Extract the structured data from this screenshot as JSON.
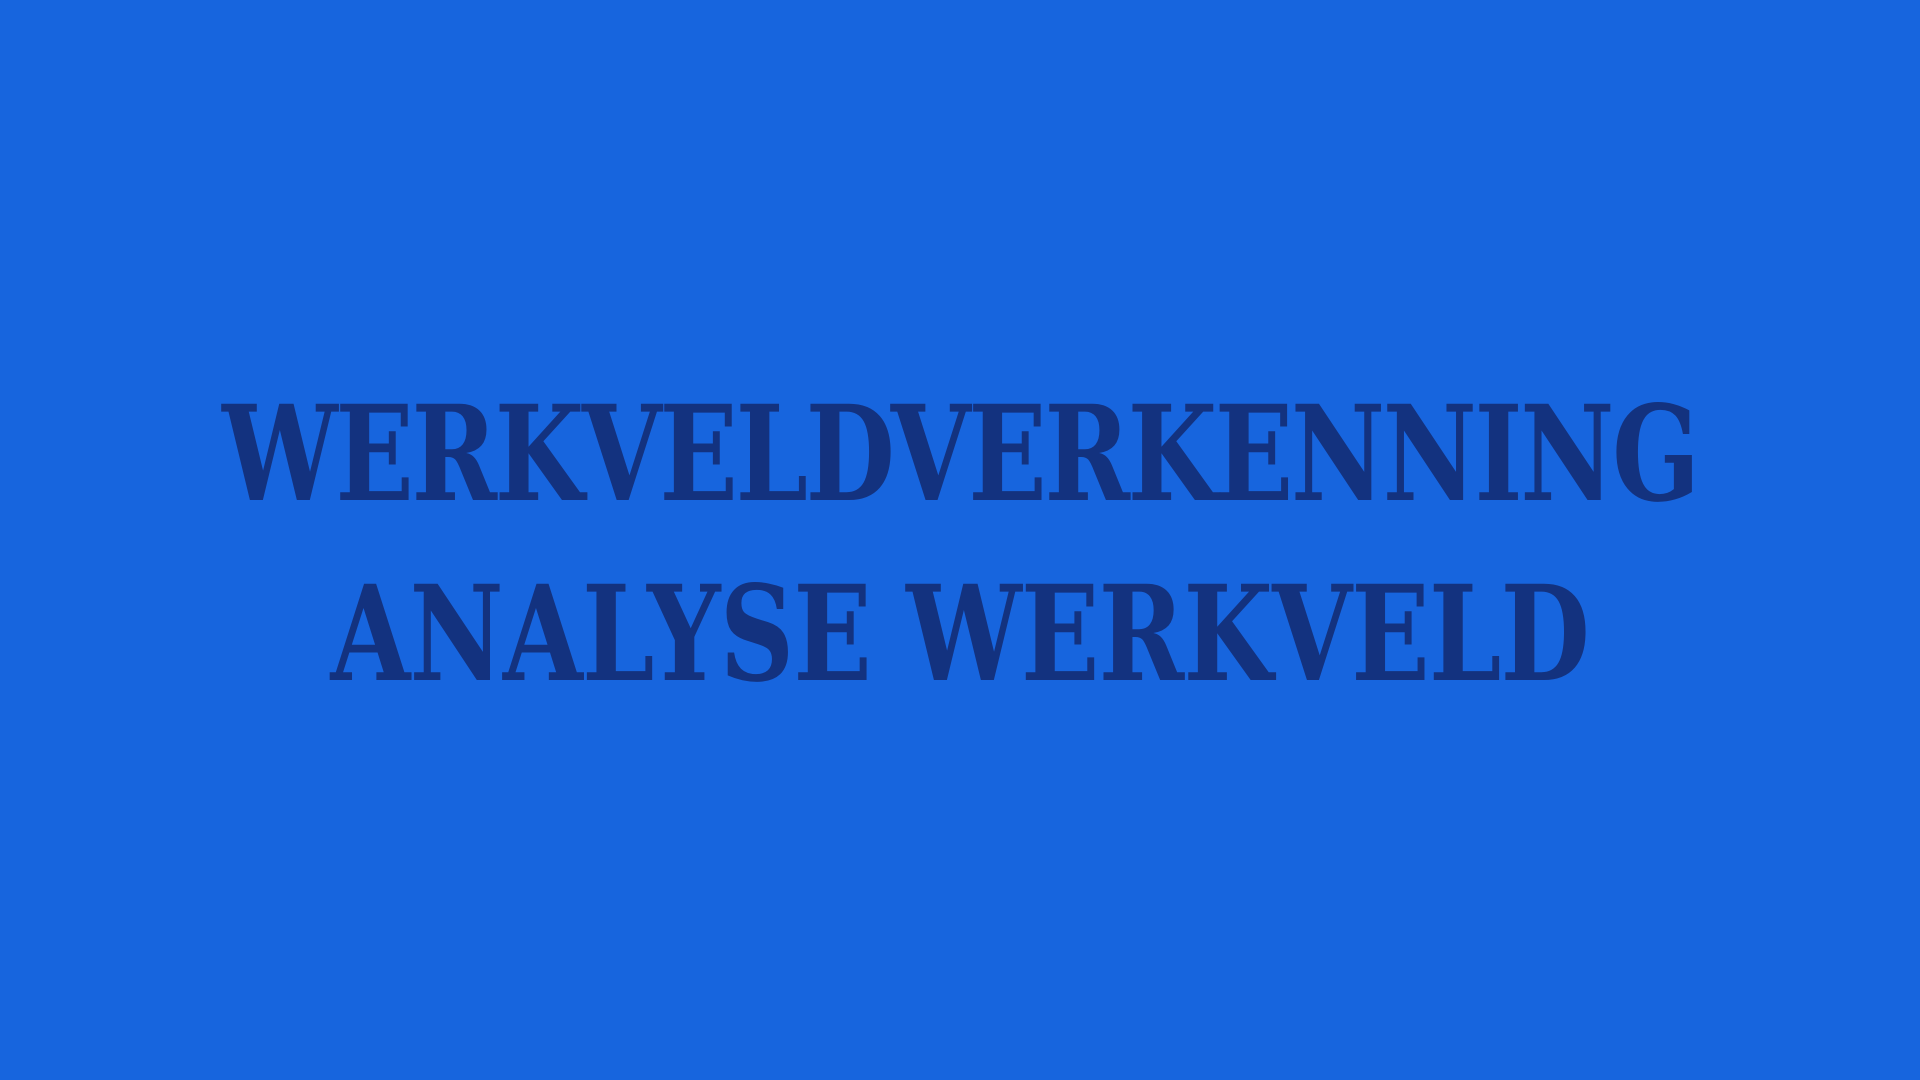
{
  "background_color": "#1765DE",
  "text_color": "#13327F",
  "title": {
    "line1": "WERKVELDVERKENNING",
    "line2": "ANALYSE WERKVELD"
  }
}
